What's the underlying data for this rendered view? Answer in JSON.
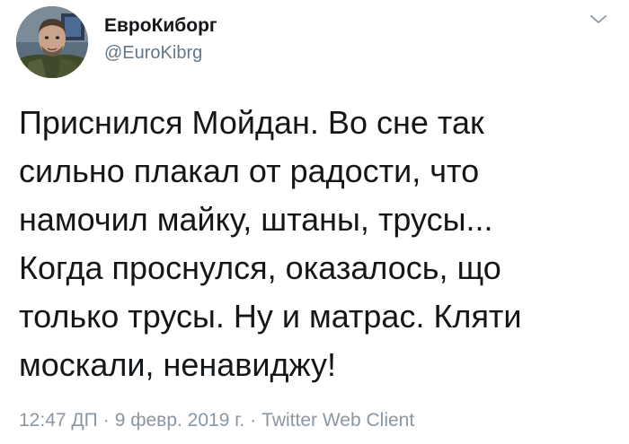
{
  "author": {
    "display_name": "ЕвроКиборг",
    "handle": "@EuroKibrg",
    "avatar_icon": "profile-photo"
  },
  "menu_icon": "chevron-down-icon",
  "tweet": {
    "lines": [
      "Приснился Мойдан. Во сне так",
      "сильно плакал от радости, что",
      "намочил майку, штаны, трусы...",
      "Когда проснулся, оказалось, що",
      "только трусы. Ну и матрас. Кляти",
      "москали, ненавиджу!"
    ]
  },
  "meta": {
    "time": "12:47 ДП",
    "separator": "·",
    "date": "9 февр. 2019 г.",
    "client": "Twitter Web Client"
  },
  "colors": {
    "text": "#14171a",
    "secondary": "#657786",
    "meta": "#8a97a3"
  }
}
